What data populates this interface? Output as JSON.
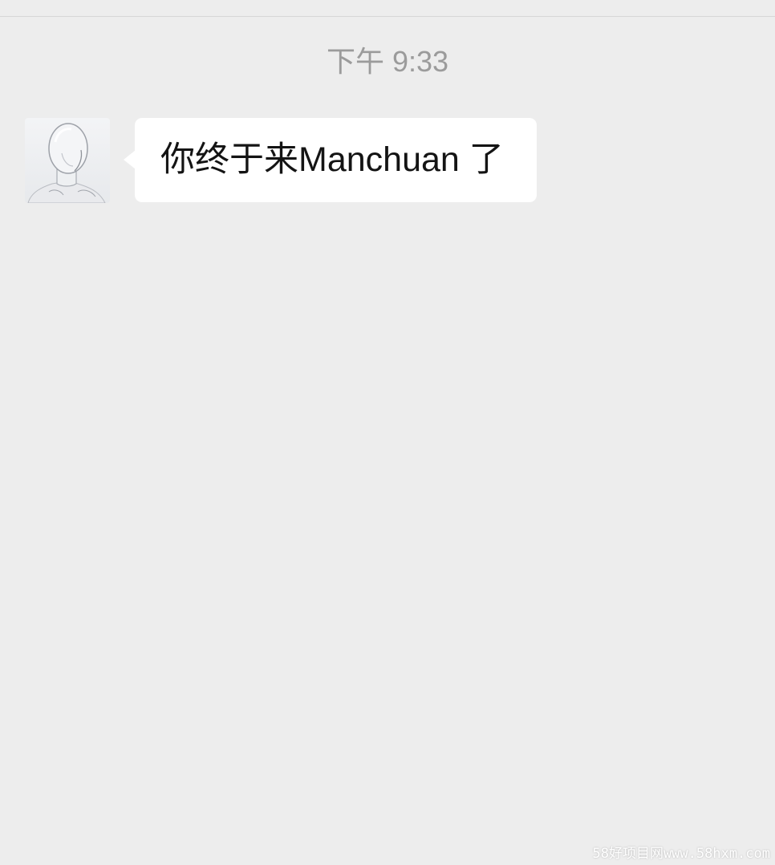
{
  "chat": {
    "timestamp": "下午 9:33",
    "messages": [
      {
        "sender": "contact",
        "avatar_icon": "mannequin-head-avatar",
        "text": "你终于来Manchuan 了"
      }
    ]
  },
  "watermark": "58好项目网www.58hxm.com",
  "colors": {
    "background": "#ededed",
    "bubble": "#ffffff",
    "timestamp": "#9b9b9b",
    "message_text": "#141414"
  }
}
